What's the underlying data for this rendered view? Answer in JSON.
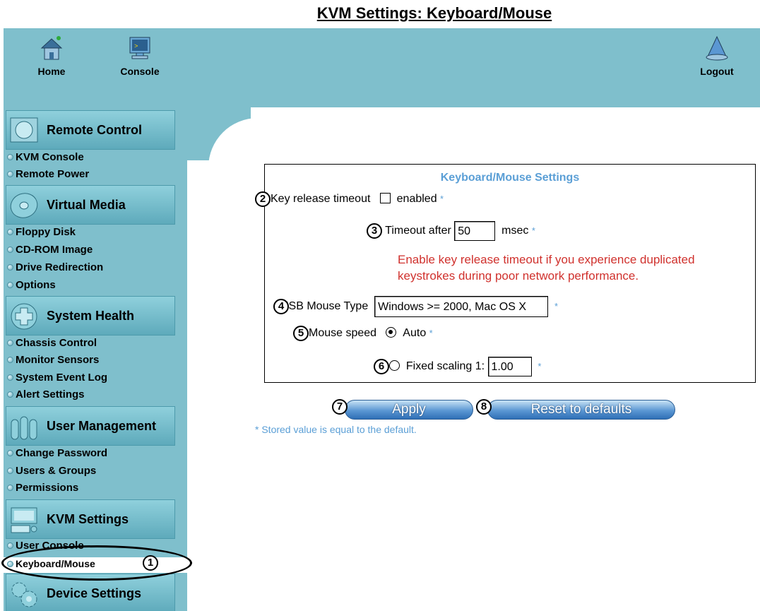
{
  "page_title": "KVM Settings: Keyboard/Mouse",
  "top_nav": {
    "home": "Home",
    "console": "Console",
    "logout": "Logout"
  },
  "sidebar": {
    "sections": [
      {
        "label": "Remote Control",
        "icon": "monitor-icon",
        "items": [
          "KVM Console",
          "Remote Power"
        ]
      },
      {
        "label": "Virtual Media",
        "icon": "disc-icon",
        "items": [
          "Floppy Disk",
          "CD-ROM Image",
          "Drive Redirection",
          "Options"
        ]
      },
      {
        "label": "System Health",
        "icon": "health-cross-icon",
        "items": [
          "Chassis Control",
          "Monitor Sensors",
          "System Event Log",
          "Alert Settings"
        ]
      },
      {
        "label": "User Management",
        "icon": "users-icon",
        "items": [
          "Change Password",
          "Users & Groups",
          "Permissions"
        ]
      },
      {
        "label": "KVM Settings",
        "icon": "keyboard-monitor-icon",
        "items": [
          "User Console",
          "Keyboard/Mouse"
        ]
      },
      {
        "label": "Device Settings",
        "icon": "gears-icon",
        "items": []
      }
    ],
    "active_item": "Keyboard/Mouse"
  },
  "form": {
    "title": "Keyboard/Mouse Settings",
    "key_release_label": "Key release timeout",
    "enabled_label": "enabled",
    "enabled_checked": false,
    "timeout_label": "Timeout after",
    "timeout_value": "50",
    "timeout_unit": "msec",
    "warning_line1": "Enable key release timeout if you experience duplicated",
    "warning_line2": "keystrokes during poor network performance.",
    "usb_mouse_label": "USB Mouse Type",
    "usb_mouse_value": "Windows >= 2000, Mac OS X",
    "mouse_speed_label": "Mouse speed",
    "auto_label": "Auto",
    "auto_selected": true,
    "fixed_label": "Fixed scaling 1:",
    "fixed_value": "1.00",
    "star": "*"
  },
  "buttons": {
    "apply": "Apply",
    "reset": "Reset to defaults"
  },
  "footnote": "* Stored value is equal to the default.",
  "callouts": [
    "1",
    "2",
    "3",
    "4",
    "5",
    "6",
    "7",
    "8"
  ],
  "colors": {
    "nav_bg": "#7fbfcc",
    "section_header": "#6fb8c8",
    "accent_blue": "#5b9fd6",
    "warning_red": "#d0312d",
    "button_blue": "#3f7fc2"
  }
}
